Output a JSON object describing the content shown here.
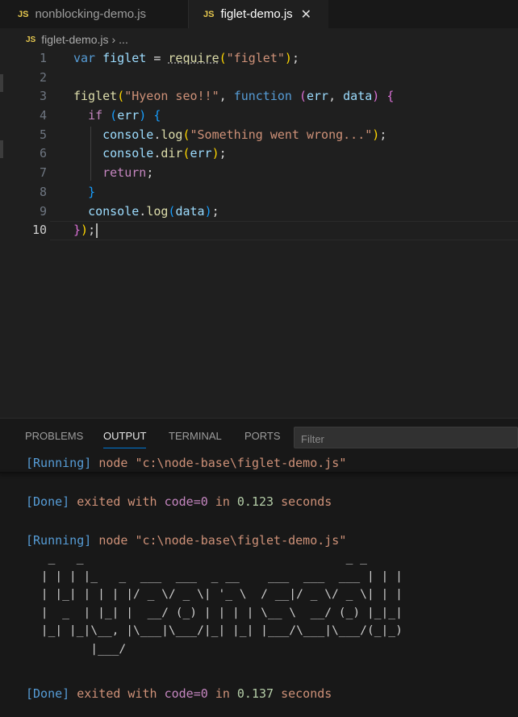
{
  "tabs": [
    {
      "icon": "JS",
      "label": "nonblocking-demo.js",
      "active": false
    },
    {
      "icon": "JS",
      "label": "figlet-demo.js",
      "active": true,
      "close": "✕"
    }
  ],
  "breadcrumb": {
    "icon": "JS",
    "file": "figlet-demo.js",
    "sep": "›",
    "more": "..."
  },
  "code_lines": [
    {
      "n": "1"
    },
    {
      "n": "2"
    },
    {
      "n": "3"
    },
    {
      "n": "4"
    },
    {
      "n": "5"
    },
    {
      "n": "6"
    },
    {
      "n": "7"
    },
    {
      "n": "8"
    },
    {
      "n": "9"
    },
    {
      "n": "10"
    }
  ],
  "panel": {
    "tabs": [
      "PROBLEMS",
      "OUTPUT",
      "TERMINAL",
      "PORTS"
    ],
    "active_tab": "OUTPUT",
    "filter_placeholder": "Filter"
  },
  "output": {
    "run1": {
      "tag": "[Running]",
      "cmd": "node \"c:\\node-base\\figlet-demo.js\""
    },
    "done1": {
      "tag": "[Done]",
      "pre": "exited with",
      "code": "code=0",
      "in": "in",
      "time": "0.123",
      "unit": "seconds"
    },
    "run2": {
      "tag": "[Running]",
      "cmd": "node \"c:\\node-base\\figlet-demo.js\""
    },
    "figlet": "  _   _                                     _ _ \n | | | |_   _  ___  ___  _ __    ___  ___  ___ | | |\n | |_| | | | |/ _ \\/ _ \\| '_ \\  / __|/ _ \\/ _ \\| | |\n |  _  | |_| |  __/ (_) | | | | \\__ \\  __/ (_) |_|_|\n |_| |_|\\__, |\\___|\\___/|_| |_| |___/\\___|\\___/(_|_)\n        |___/",
    "done2": {
      "tag": "[Done]",
      "pre": "exited with",
      "code": "code=0",
      "in": "in",
      "time": "0.137",
      "unit": "seconds"
    }
  }
}
